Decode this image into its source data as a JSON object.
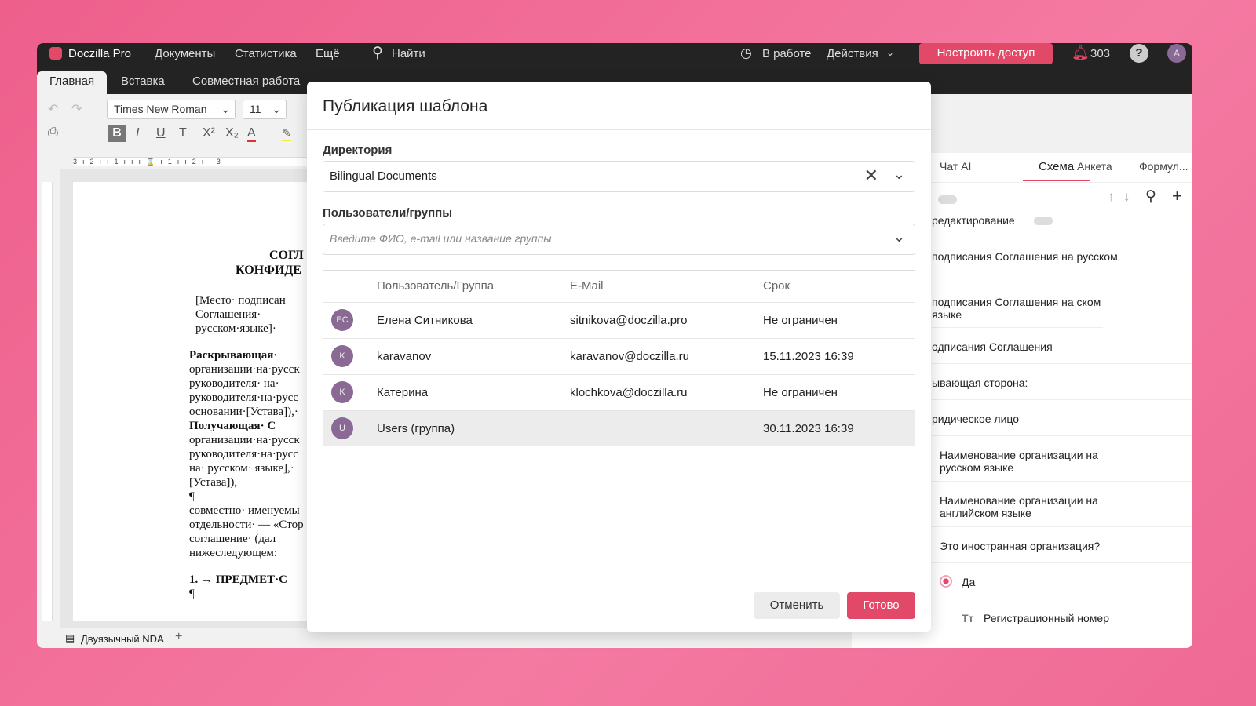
{
  "header": {
    "brand": "Doczilla Pro",
    "nav": [
      "Документы",
      "Статистика",
      "Ещё"
    ],
    "search": "Найти",
    "status": "В работе",
    "actions": "Действия",
    "access_button": "Настроить доступ",
    "notifications": "303",
    "avatar": "A"
  },
  "ribbon_tabs": [
    "Главная",
    "Вставка",
    "Совместная работа"
  ],
  "toolbar": {
    "font": "Times New Roman",
    "size": "11"
  },
  "document": {
    "title1": "СОГЛ",
    "title2": "КОНФИДЕ",
    "lines": [
      "[Место· подписан",
      "Соглашения·",
      "русском·языке]·",
      "Раскрывающая·",
      "организации·на·русск",
      "руководителя· на·",
      "руководителя·на·русс",
      "основании·[Устава]),·",
      "Получающая· С",
      "организации·на·русск",
      "руководителя·на·русс",
      "на· русском· языке],·",
      "[Устава]),",
      "¶",
      "совместно· именуемы",
      "отдельности· — «Стор",
      "соглашение· (дал",
      "нижеследующем:",
      "1. → ПРЕДМЕТ·С",
      "¶"
    ],
    "tab": "Двуязычный NDA"
  },
  "right_panel": {
    "tabs": [
      "Чат AI",
      "Схема",
      "Анкета",
      "Формул..."
    ],
    "active_tab": "Схема",
    "edit_label": "редактирование",
    "items": [
      "подписания Соглашения на русском",
      "подписания Соглашения на ском языке",
      "одписания Соглашения",
      "ывающая сторона:",
      "ридическое лицо",
      "Наименование организации на русском языке",
      "Наименование организации на английском языке",
      "Это иностранная организация?",
      "Да",
      "Регистрационный номер"
    ]
  },
  "modal": {
    "title": "Публикация шаблона",
    "dir_label": "Директория",
    "dir_value": "Bilingual Documents",
    "users_label": "Пользователи/группы",
    "users_placeholder": "Введите ФИО, e-mail или название группы",
    "columns": [
      "Пользователь/Группа",
      "E-Mail",
      "Срок"
    ],
    "rows": [
      {
        "initials": "ЕС",
        "name": "Елена Ситникова",
        "email": "sitnikova@doczilla.pro",
        "term": "Не ограничен"
      },
      {
        "initials": "K",
        "name": "karavanov",
        "email": "karavanov@doczilla.ru",
        "term": "15.11.2023 16:39"
      },
      {
        "initials": "K",
        "name": "Катерина",
        "email": "klochkova@doczilla.ru",
        "term": "Не ограничен"
      },
      {
        "initials": "U",
        "name": "Users (группа)",
        "email": "",
        "term": "30.11.2023 16:39"
      }
    ],
    "cancel": "Отменить",
    "done": "Готово"
  },
  "colors": {
    "accent": "#e24867",
    "topbar": "#232323"
  }
}
